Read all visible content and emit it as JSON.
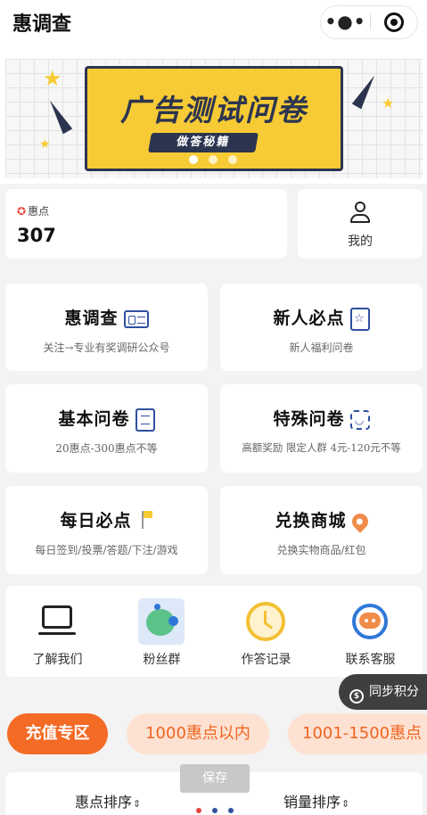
{
  "app": {
    "title": "惠调查",
    "more_icon": "•●•"
  },
  "banner": {
    "title": "广告测试问卷",
    "tag": "做答秘籍",
    "dot_count": 3,
    "active_dot": 1
  },
  "points": {
    "label": "惠点",
    "value": "307"
  },
  "mine": {
    "label": "我的"
  },
  "tiles": [
    {
      "title": "惠调查",
      "subtitle": "关注→专业有奖调研公众号",
      "icon": "id-card-icon"
    },
    {
      "title": "新人必点",
      "subtitle": "新人福利问卷",
      "icon": "star-doc-icon"
    },
    {
      "title": "基本问卷",
      "subtitle": "20惠点-300惠点不等",
      "icon": "document-icon"
    },
    {
      "title": "特殊问卷",
      "subtitle": "高额奖励 限定人群 4元-120元不等",
      "icon": "face-scan-icon"
    },
    {
      "title": "每日必点",
      "subtitle": "每日签到/投票/答题/下注/游戏",
      "icon": "flag-icon"
    },
    {
      "title": "兑换商城",
      "subtitle": "兑换实物商品/红包",
      "icon": "location-pin-icon"
    }
  ],
  "quick": [
    {
      "label": "了解我们",
      "icon": "laptop-icon"
    },
    {
      "label": "粉丝群",
      "icon": "fans-group-icon"
    },
    {
      "label": "作答记录",
      "icon": "clock-icon"
    },
    {
      "label": "联系客服",
      "icon": "customer-service-icon"
    }
  ],
  "sync": {
    "label": "同步积分",
    "icon_glyph": "$"
  },
  "categories": [
    {
      "label": "充值专区",
      "active": true
    },
    {
      "label": "1000惠点以内",
      "active": false
    },
    {
      "label": "1001-1500惠点",
      "active": false
    }
  ],
  "sort": {
    "by_points": "惠点排序",
    "by_sales": "销量排序",
    "arrow": "⇕"
  },
  "save_label": "保存",
  "colors": {
    "accent": "#f46b26",
    "chip_bg": "#fde2d3",
    "banner_yellow": "#f7cb35",
    "navy": "#2c3550",
    "icon_blue": "#2f4fa0"
  }
}
